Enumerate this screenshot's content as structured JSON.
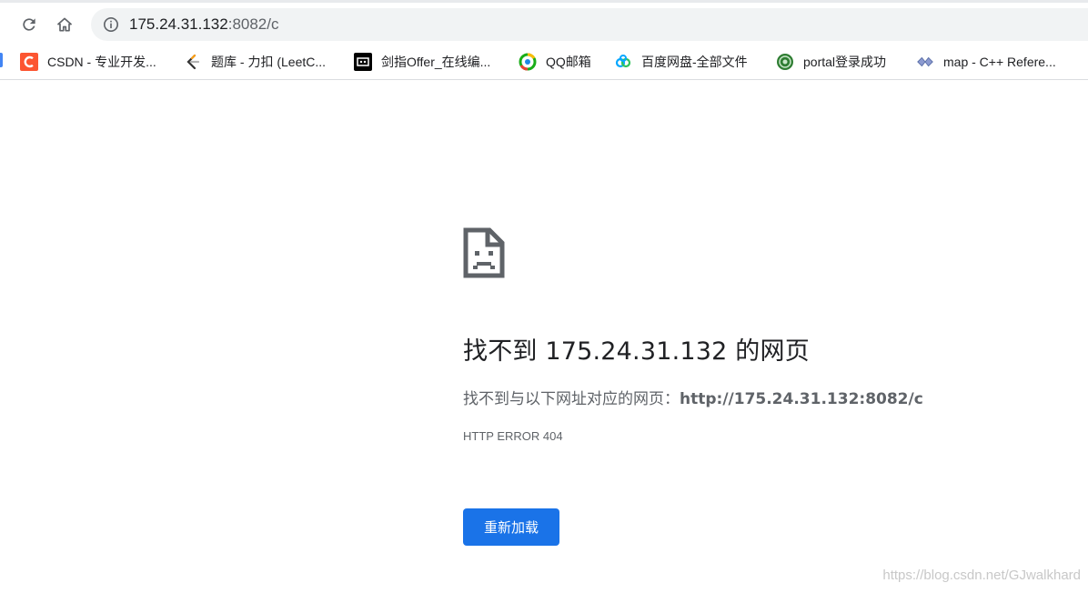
{
  "toolbar": {
    "reload_icon": "reload-icon",
    "home_icon": "home-icon",
    "url_host": "175.24.31.132",
    "url_rest": ":8082/c"
  },
  "bookmarks": [
    {
      "label": "CSDN - 专业开发...",
      "icon": "csdn-icon",
      "color": "#fc5531"
    },
    {
      "label": "题库 - 力扣 (LeetC...",
      "icon": "leetcode-icon",
      "color": "#ffa116"
    },
    {
      "label": "剑指Offer_在线编...",
      "icon": "nowcoder-icon",
      "color": "#000000"
    },
    {
      "label": "QQ邮箱",
      "icon": "qqmail-icon",
      "color": "#1aad19"
    },
    {
      "label": "百度网盘-全部文件",
      "icon": "baidupan-icon",
      "color": "#06a7ff"
    },
    {
      "label": "portal登录成功",
      "icon": "portal-icon",
      "color": "#2e7d32"
    },
    {
      "label": "map - C++ Refere...",
      "icon": "cplusplus-icon",
      "color": "#5a6fa8"
    }
  ],
  "error": {
    "icon": "sad-page-icon",
    "title": "找不到 175.24.31.132 的网页",
    "desc_prefix": "找不到与以下网址对应的网页：",
    "desc_url": "http://175.24.31.132:8082/c",
    "code": "HTTP ERROR 404",
    "reload_label": "重新加载"
  },
  "watermark": "https://blog.csdn.net/GJwalkhard",
  "colors": {
    "button": "#1a73e8",
    "text_primary": "#202124",
    "text_secondary": "#5f6368"
  }
}
